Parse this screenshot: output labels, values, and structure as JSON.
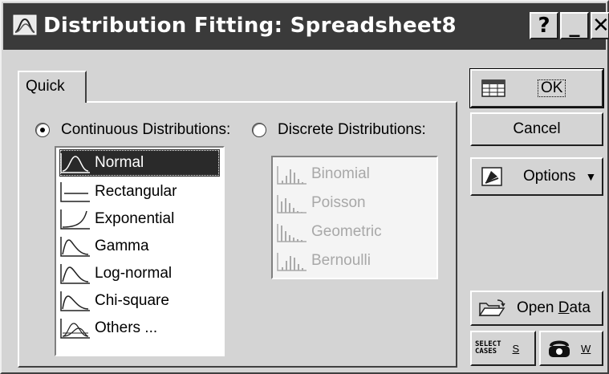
{
  "window": {
    "title": "Distribution Fitting: Spreadsheet8",
    "help_label": "?",
    "minimize_label": "_",
    "close_label": "✕"
  },
  "tabs": [
    {
      "label": "Quick"
    }
  ],
  "continuous": {
    "label": "Continuous Distributions:",
    "selected": true,
    "items": [
      {
        "label": "Normal",
        "icon": "normal-curve-icon",
        "selected": true
      },
      {
        "label": "Rectangular",
        "icon": "rectangular-icon"
      },
      {
        "label": "Exponential",
        "icon": "exponential-curve-icon"
      },
      {
        "label": "Gamma",
        "icon": "gamma-curve-icon"
      },
      {
        "label": "Log-normal",
        "icon": "lognormal-curve-icon"
      },
      {
        "label": "Chi-square",
        "icon": "chisquare-curve-icon"
      },
      {
        "label": "Others ...",
        "icon": "others-curves-icon"
      }
    ]
  },
  "discrete": {
    "label": "Discrete Distributions:",
    "selected": false,
    "disabled_list": true,
    "items": [
      {
        "label": "Binomial",
        "icon": "binomial-bars-icon"
      },
      {
        "label": "Poisson",
        "icon": "poisson-bars-icon"
      },
      {
        "label": "Geometric",
        "icon": "geometric-bars-icon"
      },
      {
        "label": "Bernoulli",
        "icon": "bernoulli-bars-icon"
      }
    ]
  },
  "buttons": {
    "ok": "OK",
    "cancel": "Cancel",
    "options": "Options",
    "open_data_prefix": "Open ",
    "open_data_hotkey": "D",
    "open_data_suffix": "ata",
    "select_cases_line1": "SELECT",
    "select_cases_line2": "CASES",
    "select_cases_key": "S",
    "weight_key": "W"
  }
}
